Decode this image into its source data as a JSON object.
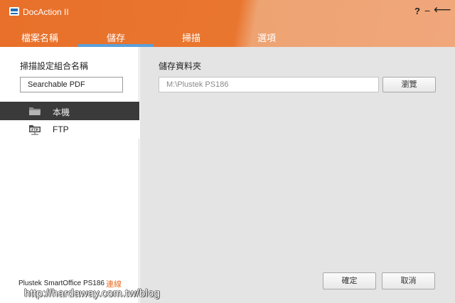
{
  "app": {
    "title": "DocAction II"
  },
  "window_controls": {
    "help": "?",
    "minimize": "−",
    "back": "⟵"
  },
  "tabs": [
    {
      "label": "檔案名稱"
    },
    {
      "label": "儲存",
      "active": true
    },
    {
      "label": "掃描"
    },
    {
      "label": "選項"
    }
  ],
  "left_panel": {
    "profile_label": "掃描設定組合名稱",
    "profile_value": "Searchable PDF",
    "destinations": [
      {
        "label": "本機",
        "icon": "folder-icon",
        "selected": true
      },
      {
        "label": "FTP",
        "icon": "ftp-folder-icon",
        "selected": false
      }
    ],
    "device_name": "Plustek SmartOffice PS186",
    "connect_label": "連線"
  },
  "right_panel": {
    "folder_label": "儲存資料夾",
    "folder_value": "M:\\Plustek PS186",
    "browse_label": "瀏覽",
    "ok_label": "確定",
    "cancel_label": "取消"
  },
  "watermark": "http://hardaway.com.tw/blog",
  "colors": {
    "accent": "#e8702a",
    "tab_indicator": "#5aa0d9",
    "selected_row": "#3a3a3a",
    "panel_bg": "#e4e4e4"
  }
}
